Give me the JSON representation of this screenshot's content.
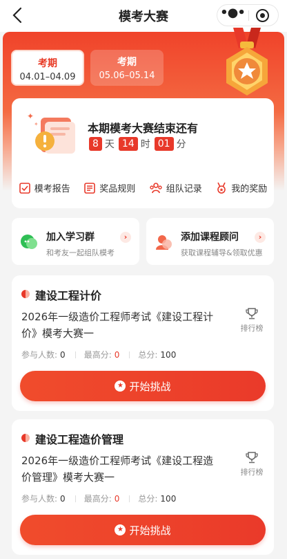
{
  "header": {
    "title": "模考大赛",
    "back_icon": "back-arrow-icon",
    "more_icon": "more-dots-icon",
    "close_icon": "mini-program-close-icon"
  },
  "periods": [
    {
      "label": "考期",
      "dates": "04.01–04.09",
      "selected": true
    },
    {
      "label": "考期",
      "dates": "05.06–05.14",
      "selected": false
    }
  ],
  "countdown": {
    "title": "本期模考大赛结束还有",
    "days": "8",
    "days_unit": "天",
    "hours": "14",
    "hours_unit": "时",
    "minutes": "01",
    "minutes_unit": "分"
  },
  "menu": [
    {
      "label": "模考报告",
      "icon": "report-icon"
    },
    {
      "label": "奖品规则",
      "icon": "rules-list-icon"
    },
    {
      "label": "组队记录",
      "icon": "team-icon"
    },
    {
      "label": "我的奖励",
      "icon": "reward-icon"
    }
  ],
  "promos": [
    {
      "title": "加入学习群",
      "subtitle": "和考友一起组队模考",
      "icon": "chat-group-icon"
    },
    {
      "title": "添加课程顾问",
      "subtitle": "获取课程辅导&领取优惠",
      "icon": "advisor-icon"
    }
  ],
  "competitions": [
    {
      "name": "建设工程计价",
      "desc": "2026年一级造价工程师考试《建设工程计价》模考大赛一",
      "rank_label": "排行榜",
      "participants_label": "参与人数:",
      "participants": "0",
      "max_label": "最高分:",
      "max": "0",
      "total_label": "总分:",
      "total": "100",
      "button": "开始挑战"
    },
    {
      "name": "建设工程造价管理",
      "desc": "2026年一级造价工程师考试《建设工程造价管理》模考大赛一",
      "rank_label": "排行榜",
      "participants_label": "参与人数:",
      "participants": "0",
      "max_label": "最高分:",
      "max": "0",
      "total_label": "总分:",
      "total": "100",
      "button": "开始挑战"
    }
  ],
  "colors": {
    "accent": "#e8392a",
    "hero_top": "#f0432a",
    "background": "#f4f4f4"
  }
}
